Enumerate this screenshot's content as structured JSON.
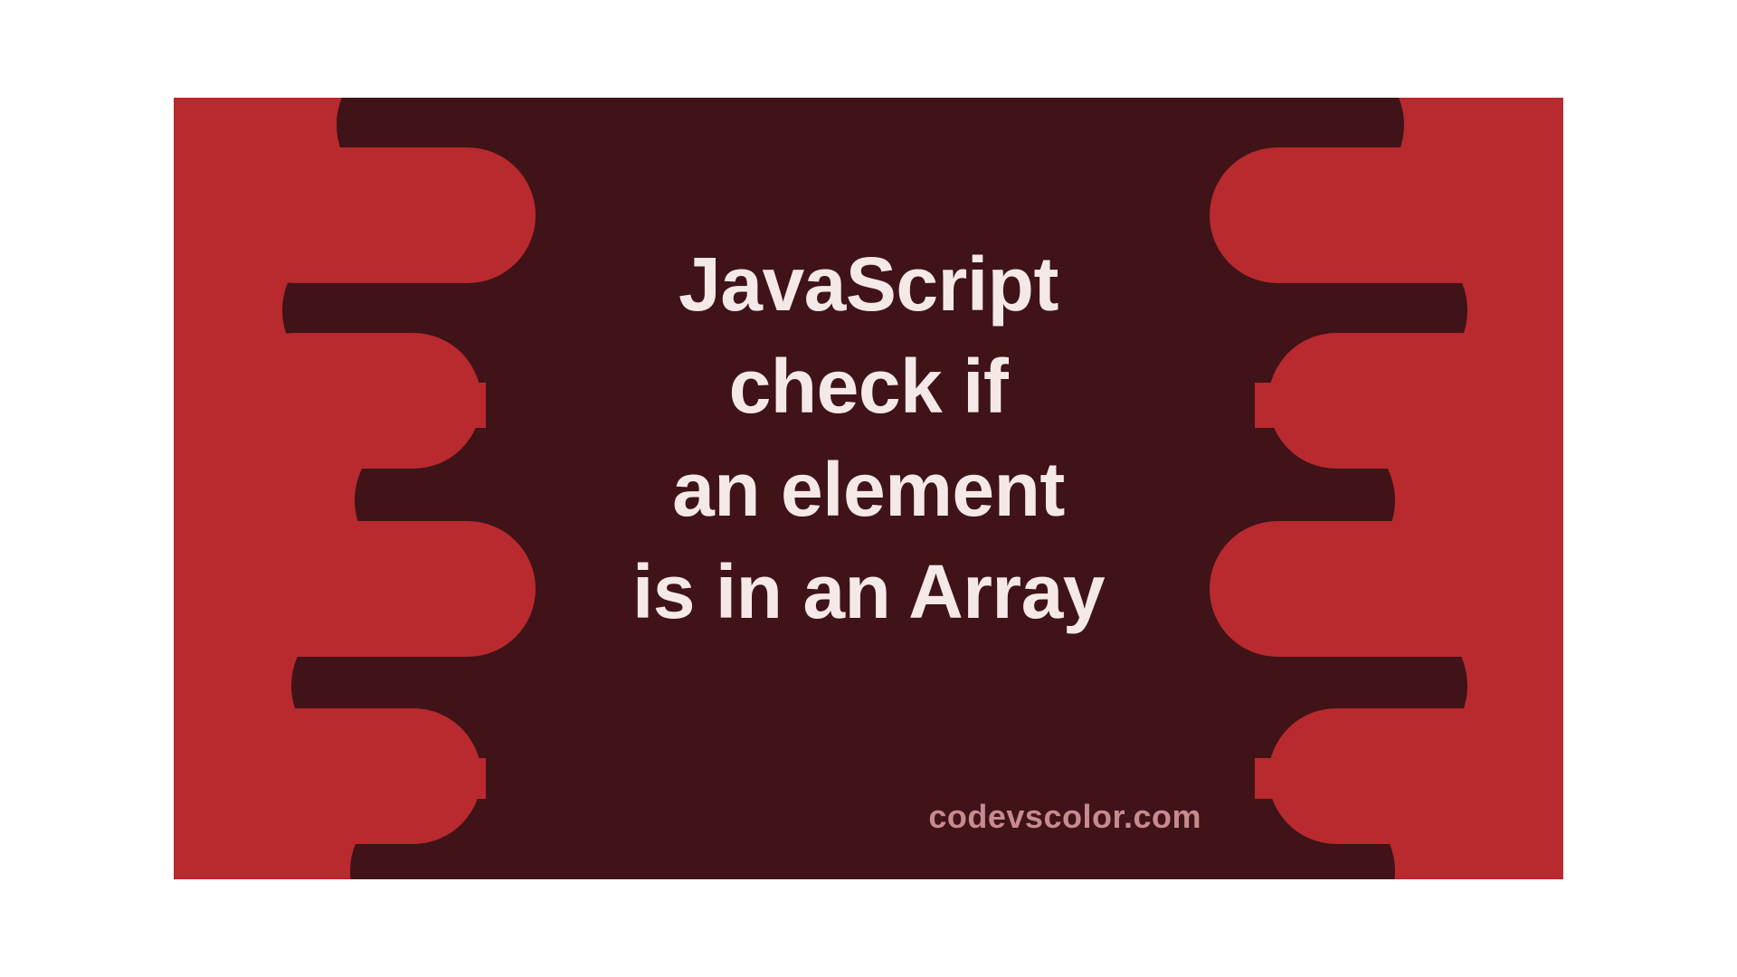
{
  "title_lines": [
    "JavaScript",
    "check if",
    "an element",
    "is in an Array"
  ],
  "site": "codevscolor.com",
  "colors": {
    "background": "#b82a2e",
    "blob": "#3f1317",
    "text": "#f5e9e8",
    "site_text": "#c78a8e"
  }
}
